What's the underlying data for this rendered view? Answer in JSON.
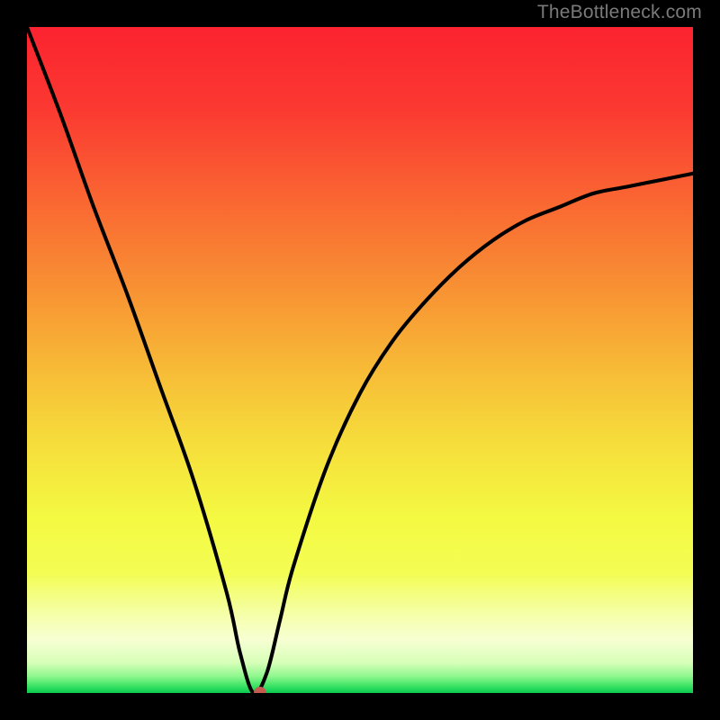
{
  "watermark": "TheBottleneck.com",
  "chart_data": {
    "type": "line",
    "title": "",
    "xlabel": "",
    "ylabel": "",
    "xlim": [
      0,
      100
    ],
    "ylim": [
      0,
      100
    ],
    "grid": false,
    "legend": false,
    "description": "Bottleneck curve: a V-shaped line over a vertical heatmap gradient (red at top = high bottleneck, green at bottom = low). The curve descends steeply to a near-zero minimum around x≈34 then rises with curvature toward the right side, topping out near y≈78 at x=100.",
    "series": [
      {
        "name": "bottleneck-curve",
        "x": [
          0,
          5,
          10,
          15,
          20,
          25,
          30,
          32,
          34,
          36,
          38,
          40,
          45,
          50,
          55,
          60,
          65,
          70,
          75,
          80,
          85,
          90,
          95,
          100
        ],
        "values": [
          100,
          87,
          73,
          60,
          46,
          32,
          15,
          6,
          0,
          3,
          11,
          19,
          34,
          45,
          53,
          59,
          64,
          68,
          71,
          73,
          75,
          76,
          77,
          78
        ]
      }
    ],
    "marker": {
      "x": 35,
      "y": 0,
      "color": "#c65b52"
    },
    "gradient_stops": [
      {
        "offset": 0.0,
        "color": "#fb2330"
      },
      {
        "offset": 0.12,
        "color": "#fb3831"
      },
      {
        "offset": 0.25,
        "color": "#fa6332"
      },
      {
        "offset": 0.38,
        "color": "#f88d33"
      },
      {
        "offset": 0.5,
        "color": "#f7b636"
      },
      {
        "offset": 0.62,
        "color": "#f6dc3b"
      },
      {
        "offset": 0.74,
        "color": "#f4fa42"
      },
      {
        "offset": 0.82,
        "color": "#f3fd53"
      },
      {
        "offset": 0.88,
        "color": "#f5ffa6"
      },
      {
        "offset": 0.92,
        "color": "#f7ffd3"
      },
      {
        "offset": 0.955,
        "color": "#d6ffb8"
      },
      {
        "offset": 0.975,
        "color": "#8ef78d"
      },
      {
        "offset": 0.99,
        "color": "#39e263"
      },
      {
        "offset": 1.0,
        "color": "#08c94f"
      }
    ]
  }
}
